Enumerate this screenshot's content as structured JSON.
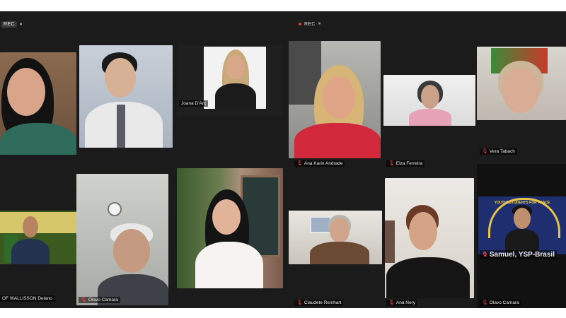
{
  "left_window": {
    "rec_label": "REC",
    "participants": [
      {
        "name": ""
      },
      {
        "name": ""
      },
      {
        "name": "Joana D'Arc"
      },
      {
        "name": "OF WALLISSON Delano"
      },
      {
        "name": "Olavo Camara"
      },
      {
        "name": ""
      }
    ]
  },
  "right_window": {
    "rec_label": "REC",
    "participants": [
      {
        "name": "Ana Karin Andrade"
      },
      {
        "name": "Elza Ferreira"
      },
      {
        "name": "Vera Tabach"
      },
      {
        "name": "Claudete Reinhart"
      },
      {
        "name": "Ana Nery"
      },
      {
        "name": "Olavo Camara"
      }
    ],
    "banner_name": "Samuel, YSP-Brasil",
    "banner_text": "YOUTH&STUDENTS FOR PEACE"
  },
  "colors": {
    "background": "#1b1b1b",
    "mic_muted": "#ff3b3b",
    "rec_dot": "#e23b3b"
  }
}
